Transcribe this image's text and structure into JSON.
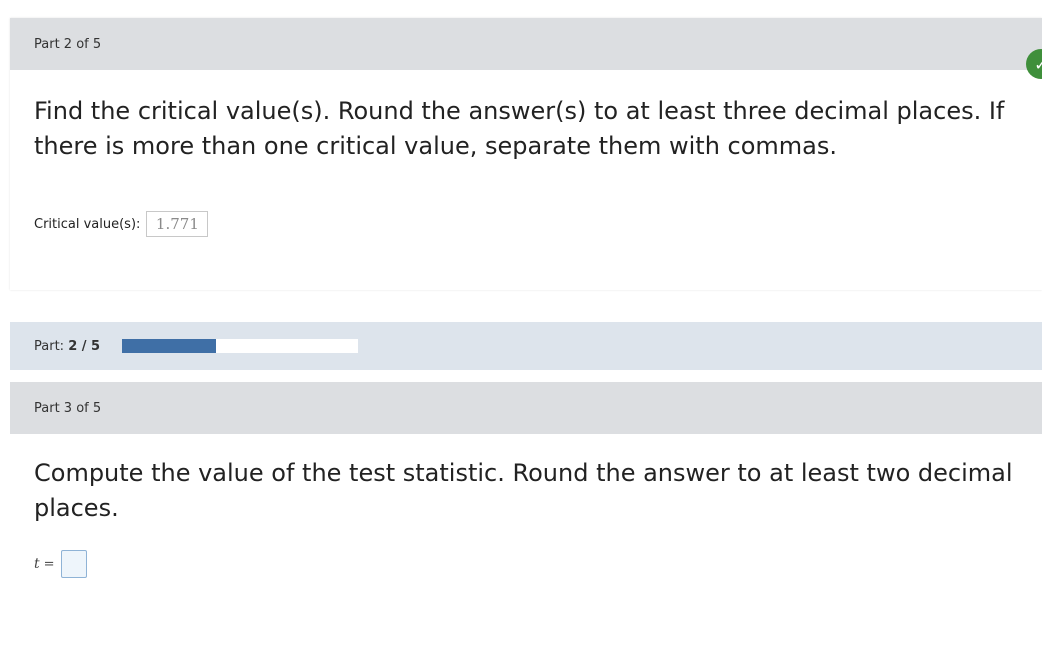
{
  "part2": {
    "header": "Part 2 of 5",
    "question": "Find the critical value(s). Round the answer(s) to at least three decimal places. If there is more than one critical value, separate them with commas.",
    "answer_label": "Critical value(s):",
    "answer_value": "1.771",
    "status_icon": "check-icon"
  },
  "progress": {
    "label_prefix": "Part:",
    "label_value": "2 / 5",
    "fraction": 0.4,
    "fill_color": "#3f6fa6"
  },
  "part3": {
    "header": "Part 3 of 5",
    "question": "Compute the value of the test statistic. Round the answer to at least two decimal places.",
    "variable": "t",
    "equals": "=",
    "answer_value": ""
  }
}
